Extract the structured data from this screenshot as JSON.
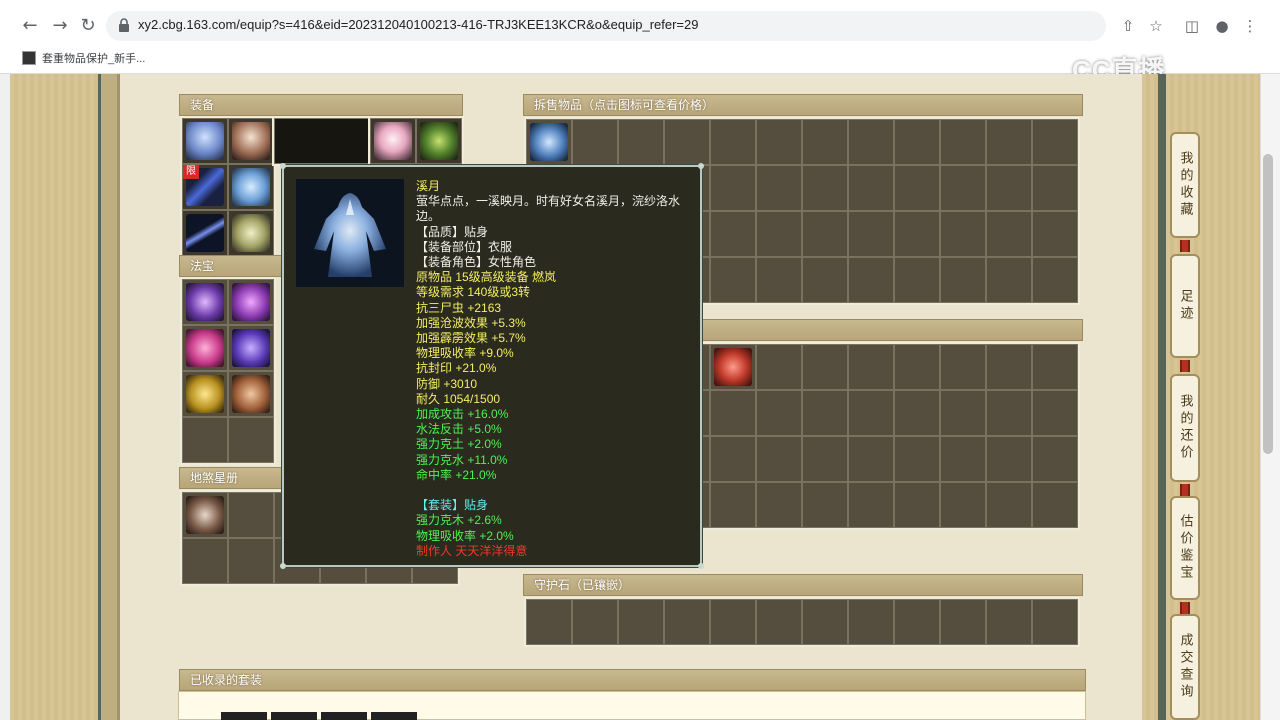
{
  "browser": {
    "url": "xy2.cbg.163.com/equip?s=416&eid=202312040100213-416-TRJ3KEE13KCR&o&equip_refer=29",
    "bookmark_label": "套重物品保护_新手..."
  },
  "watermark_text": "CC直播",
  "panels": {
    "equipment_title": "装备",
    "fabao_title": "法宝",
    "disha_title": "地煞星册",
    "sell_items_title": "拆售物品（点击图标可查看价格）",
    "guard_stone_title": "守护石（已镶嵌）",
    "suits_title": "已收录的套装"
  },
  "xian_badge": "限",
  "tooltip": {
    "name": "溪月",
    "lines": [
      {
        "text": "萤华点点，一溪映月。时有好女名溪月，浣纱洛水边。",
        "color": "white"
      },
      {
        "text": "【品质】贴身",
        "color": "white"
      },
      {
        "text": "【装备部位】衣服",
        "color": "white"
      },
      {
        "text": "【装备角色】女性角色",
        "color": "white"
      },
      {
        "text": "原物品 15级高级装备 燃岚",
        "color": "yellow"
      },
      {
        "text": "等级需求 140级或3转",
        "color": "yellow"
      },
      {
        "text": "抗三尸虫 +2163",
        "color": "yellow"
      },
      {
        "text": "加强沧波效果 +5.3%",
        "color": "yellow"
      },
      {
        "text": "加强霹雳效果 +5.7%",
        "color": "yellow"
      },
      {
        "text": "物理吸收率 +9.0%",
        "color": "yellow"
      },
      {
        "text": "抗封印 +21.0%",
        "color": "yellow"
      },
      {
        "text": "防御 +3010",
        "color": "yellow"
      },
      {
        "text": "耐久 1054/1500",
        "color": "yellow"
      },
      {
        "text": "加成攻击 +16.0%",
        "color": "green"
      },
      {
        "text": "水法反击 +5.0%",
        "color": "green"
      },
      {
        "text": "强力克土 +2.0%",
        "color": "green"
      },
      {
        "text": "强力克水 +11.0%",
        "color": "green"
      },
      {
        "text": "命中率 +21.0%",
        "color": "green"
      },
      {
        "text": "",
        "color": "white"
      },
      {
        "text": "【套装】贴身",
        "color": "cyan"
      },
      {
        "text": "强力克木 +2.6%",
        "color": "green"
      },
      {
        "text": "物理吸收率 +2.0%",
        "color": "green"
      },
      {
        "text": "制作人 天天洋洋得意",
        "color": "red"
      }
    ]
  },
  "side_tabs": [
    {
      "label": "我的收藏"
    },
    {
      "label": "足迹"
    },
    {
      "label": "我的还价"
    },
    {
      "label": "估价鉴宝"
    },
    {
      "label": "成交查询"
    }
  ],
  "colors": {
    "panel_title_bg": "#b8a578",
    "cell_bg": "#554d3e",
    "tooltip_bg": "#2a2a1f",
    "yellow_text": "#f4ef63",
    "green_text": "#4ef255",
    "cyan_text": "#5ef0ee",
    "red_text": "#ee3b2b"
  }
}
